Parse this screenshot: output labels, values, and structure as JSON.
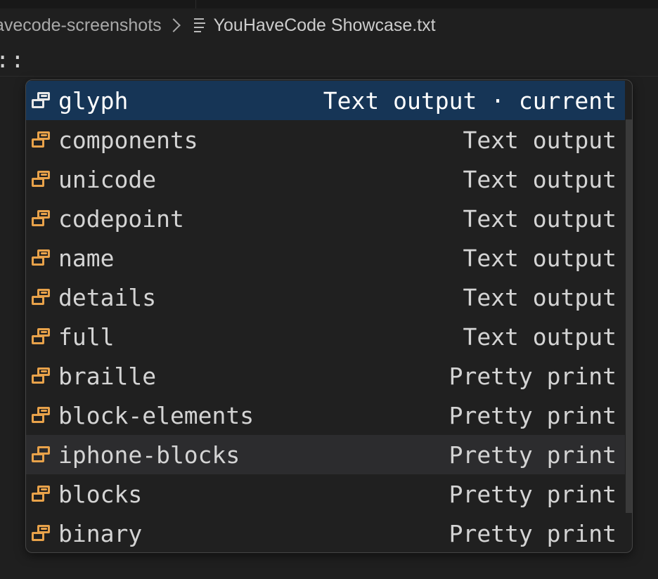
{
  "breadcrumb": {
    "folder": "avecode-screenshots",
    "file": "YouHaveCode Showcase.txt"
  },
  "editor": {
    "line_text": "::"
  },
  "suggestions": {
    "items": [
      {
        "label": "glyph",
        "detail": "Text output · current"
      },
      {
        "label": "components",
        "detail": "Text output"
      },
      {
        "label": "unicode",
        "detail": "Text output"
      },
      {
        "label": "codepoint",
        "detail": "Text output"
      },
      {
        "label": "name",
        "detail": "Text output"
      },
      {
        "label": "details",
        "detail": "Text output"
      },
      {
        "label": "full",
        "detail": "Text output"
      },
      {
        "label": "braille",
        "detail": "Pretty print"
      },
      {
        "label": "block-elements",
        "detail": "Pretty print"
      },
      {
        "label": "iphone-blocks",
        "detail": "Pretty print"
      },
      {
        "label": "blocks",
        "detail": "Pretty print"
      },
      {
        "label": "binary",
        "detail": "Pretty print"
      }
    ],
    "selected_index": 0,
    "hovered_index": 9,
    "icon": "snippet-icon",
    "icon_color": "#e8a24a",
    "selected_bg": "#163556"
  }
}
